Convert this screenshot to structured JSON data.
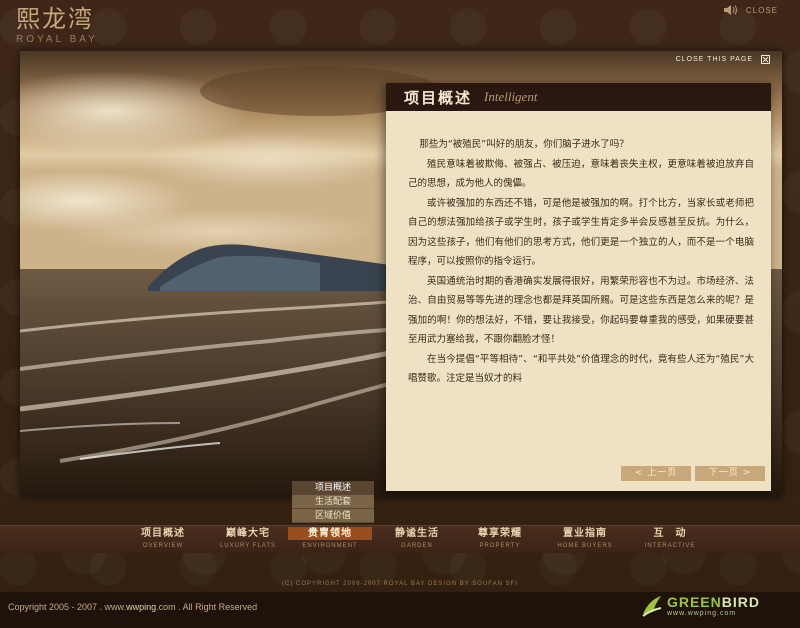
{
  "brand": {
    "name_cn": "熙龙湾",
    "name_en": "ROYAL BAY"
  },
  "top_controls": {
    "close_label": "CLOSE"
  },
  "panel": {
    "close_page_label": "CLOSE THIS PAGE"
  },
  "article": {
    "title_cn": "项目概述",
    "title_en": "Intelligent",
    "paragraphs": [
      "那些为“被殖民”叫好的朋友，你们脑子进水了吗？",
      "殖民意味着被欺侮、被强占、被压迫，意味着丧失主权，更意味着被迫放弃自己的思想，成为他人的傀儡。",
      "或许被强加的东西还不错，可是他是被强加的啊。打个比方，当家长或老师把自己的想法强加给孩子或学生时，孩子或学生肯定多半会反感甚至反抗。为什么，因为这些孩子，他们有他们的思考方式，他们更是一个独立的人，而不是一个电脑程序，可以按照你的指令运行。",
      "英国通统治时期的香港确实发展得很好，用繁荣形容也不为过。市场经济、法治、自由贸易等等先进的理念也都是拜英国所赐。可是这些东西是怎么来的呢？是强加的啊！你的想法好，不错，要让我接受，你起码要尊重我的感受，如果硬要甚至用武力塞给我，不跟你翻脸才怪！",
      "在当今提倡“平等相待”、“和平共处”价值理念的时代，竟有些人还为“殖民”大唱赞歌。注定是当奴才的料"
    ],
    "prev_label": "< 上一页",
    "next_label": "下一页 >"
  },
  "submenu": {
    "items": [
      "项目概述",
      "生活配套",
      "区域价值"
    ],
    "active_index": 0
  },
  "nav": {
    "items": [
      {
        "cn": "项目概述",
        "en": "OVERVIEW"
      },
      {
        "cn": "巅峰大宅",
        "en": "LUXURY FLATS"
      },
      {
        "cn": "贵胄领地",
        "en": "ENVIRONMENT"
      },
      {
        "cn": "静谧生活",
        "en": "GARDEN"
      },
      {
        "cn": "尊享荣耀",
        "en": "PROPERTY"
      },
      {
        "cn": "置业指南",
        "en": "HOME BUYERS"
      },
      {
        "cn": "互　动",
        "en": "INTERACTIVE"
      }
    ],
    "active_index": 2
  },
  "copyright_mid": "(C) COPYRIGHT 2006-2007 ROYAL BAY   DESIGN BY SOUFAN SFI",
  "footer": {
    "prefix": "Copyright 2005 - 2007 . www.",
    "site": "wwping",
    "suffix": ".com . All Right Reserved",
    "logo_part1": "GREEN",
    "logo_part2": "BIRD",
    "logo_url": "www.wwping.com"
  },
  "colors": {
    "accent": "#9a4e1e",
    "header_bg": "#2a1810",
    "paper": "#efe2c4",
    "greenbird": "#9cc43a"
  }
}
